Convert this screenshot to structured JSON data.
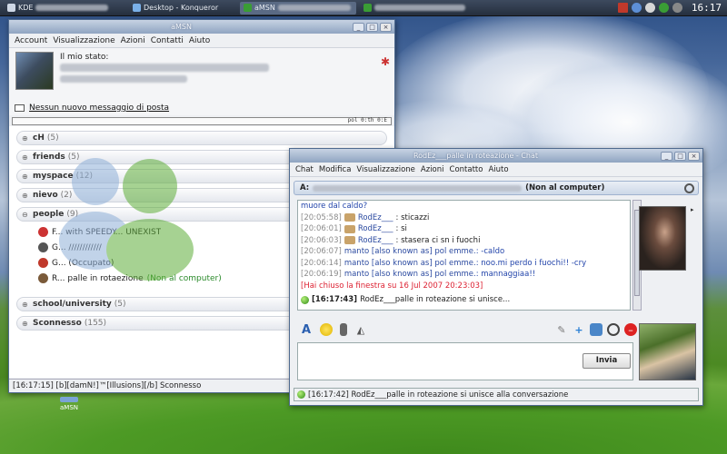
{
  "taskbar": {
    "tasks": [
      {
        "label": "KDE",
        "color": "#cfd8e6"
      },
      {
        "label": "aMSN",
        "color": "#3aa0ff"
      },
      {
        "label": "Desktop - Konqueror",
        "color": "#7ab0e8"
      },
      {
        "label": "aMSN",
        "color": "#3a9d35"
      },
      {
        "label": "aMSN",
        "color": "#3a9d35"
      }
    ],
    "clock": "16:17"
  },
  "main_window": {
    "title": "aMSN",
    "menu": [
      "Account",
      "Visualizzazione",
      "Azioni",
      "Contatti",
      "Aiuto"
    ],
    "status_label": "Il mio stato:",
    "mail_text": "Nessun nuovo messaggio di posta",
    "groups": [
      {
        "name": "cH",
        "count": "(5)",
        "expanded": false
      },
      {
        "name": "friends",
        "count": "(5)",
        "expanded": false
      },
      {
        "name": "myspace",
        "count": "(12)",
        "expanded": false
      },
      {
        "name": "nievo",
        "count": "(2)",
        "expanded": false
      },
      {
        "name": "people",
        "count": "(9)",
        "expanded": true
      }
    ],
    "people_contacts": [
      {
        "name": "F... with SPEEDY... UNEXIST",
        "status": "",
        "icon_color": "#cc3333"
      },
      {
        "name": "G... ////////////",
        "status": "",
        "icon_color": "#555555"
      },
      {
        "name": "G... (Occupato)",
        "status": "",
        "icon_color": "#c0392b"
      },
      {
        "name": "R... palle in rotaezione",
        "status": "(Non al computer)",
        "icon_color": "#7a5a3a"
      }
    ],
    "groups_after": [
      {
        "name": "school/university",
        "count": "(5)",
        "expanded": false
      },
      {
        "name": "Sconnesso",
        "count": "(155)",
        "expanded": false
      }
    ],
    "statusbar": "[16:17:15] [b][damN!]™[Illusions][/b] Sconnesso"
  },
  "chat_window": {
    "title": "RodEz___palle in roteazione - Chat",
    "menu": [
      "Chat",
      "Modifica",
      "Visualizzazione",
      "Azioni",
      "Contatto",
      "Aiuto"
    ],
    "to_label": "A:",
    "to_status": "(Non al computer)",
    "lines": [
      {
        "kind": "plain",
        "text": "muore dal caldo?"
      },
      {
        "kind": "peer",
        "time": "[20:05:58]",
        "nick": "RodEz___",
        "text": ": sticazzi"
      },
      {
        "kind": "peer",
        "time": "[20:06:01]",
        "nick": "RodEz___",
        "text": ": si"
      },
      {
        "kind": "peer",
        "time": "[20:06:03]",
        "nick": "RodEz___",
        "text": ": stasera ci sn i fuochi"
      },
      {
        "kind": "self",
        "time": "[20:06:07]",
        "nick": "manto [also known as]  pol emme.",
        "text": ": -caldo"
      },
      {
        "kind": "self",
        "time": "[20:06:14]",
        "nick": "manto [also known as]  pol emme.",
        "text": ": noo.mi perdo i fuochi!! -cry"
      },
      {
        "kind": "self",
        "time": "[20:06:19]",
        "nick": "manto [also known as]  pol emme.",
        "text": ": mannaggiaa!!"
      },
      {
        "kind": "closed",
        "text": "[Hai chiuso la finestra su 16 Jul 2007 20:23:03]"
      },
      {
        "kind": "joined",
        "time": "[16:17:43]",
        "text": "RodEz___palle in roteazione si unisce..."
      }
    ],
    "toolbar_icons": [
      "font-icon",
      "smiley-icon",
      "voice-clip-icon",
      "nudge-icon"
    ],
    "toolbar_right_icons": [
      "wink-icon",
      "invite-icon",
      "send-file-icon",
      "webcam-icon",
      "block-icon"
    ],
    "send_label": "Invia",
    "status": "[16:17:42] RodEz___palle in roteazione si unisce alla conversazione"
  },
  "desktop_icon_label": "aMSN"
}
